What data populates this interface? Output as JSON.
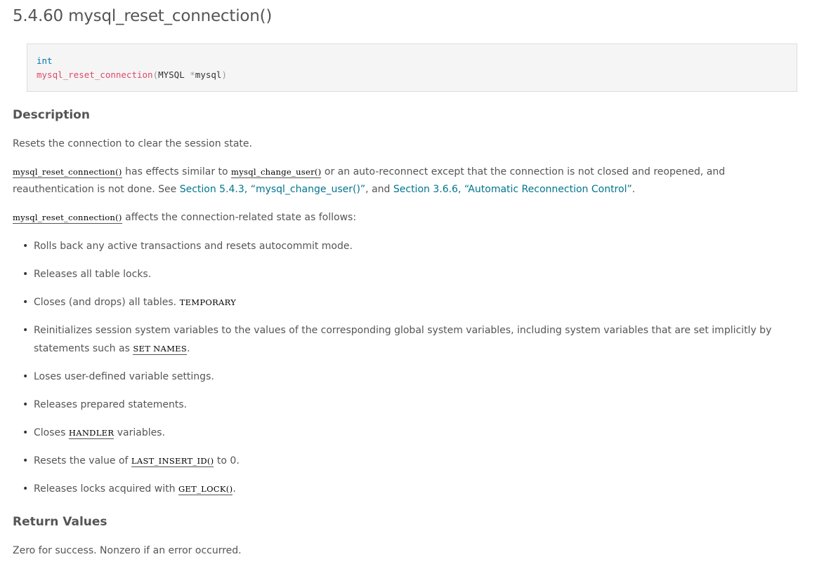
{
  "title": "5.4.60 mysql_reset_connection()",
  "signature": {
    "return_type": "int",
    "function_name": "mysql_reset_connection",
    "open_paren": "(",
    "param_type": "MYSQL ",
    "pointer": "*",
    "param_name": "mysql",
    "close_paren": ")"
  },
  "description": {
    "heading": "Description",
    "p1": "Resets the connection to clear the session state.",
    "p2": {
      "code1": "mysql_reset_connection()",
      "text1": " has effects similar to ",
      "code2": "mysql_change_user()",
      "text2": " or an auto-reconnect except that the connection is not closed and reopened, and reauthentication is not done. See ",
      "link1": "Section 5.4.3, “mysql_change_user()”",
      "text3": ", and ",
      "link2": "Section 3.6.6, “Automatic Reconnection Control”",
      "text4": "."
    },
    "p3": {
      "code": "mysql_reset_connection()",
      "text": " affects the connection-related state as follows:"
    },
    "bullets": {
      "b1": "Rolls back any active transactions and resets autocommit mode.",
      "b2": "Releases all table locks.",
      "b3_text": "Closes (and drops) all tables. ",
      "b3_code": "TEMPORARY",
      "b4_text": "Reinitializes session system variables to the values of the corresponding global system variables, including system variables that are set implicitly by statements such as ",
      "b4_code": "SET NAMES",
      "b4_end": ".",
      "b5": "Loses user-defined variable settings.",
      "b6": "Releases prepared statements.",
      "b7_text": "Closes ",
      "b7_code": "HANDLER",
      "b7_end": " variables.",
      "b8_text": "Resets the value of ",
      "b8_code": "LAST_INSERT_ID()",
      "b8_end": " to 0.",
      "b9_text": "Releases locks acquired with ",
      "b9_code": "GET_LOCK()",
      "b9_end": "."
    }
  },
  "return_values": {
    "heading": "Return Values",
    "text": "Zero for success. Nonzero if an error occurred."
  },
  "colors": {
    "text": "#555555",
    "link": "#00758f",
    "code_type": "#0077aa",
    "code_function": "#dd4a68",
    "code_box_bg": "#f5f5f5"
  },
  "bullet_glyph": "•"
}
